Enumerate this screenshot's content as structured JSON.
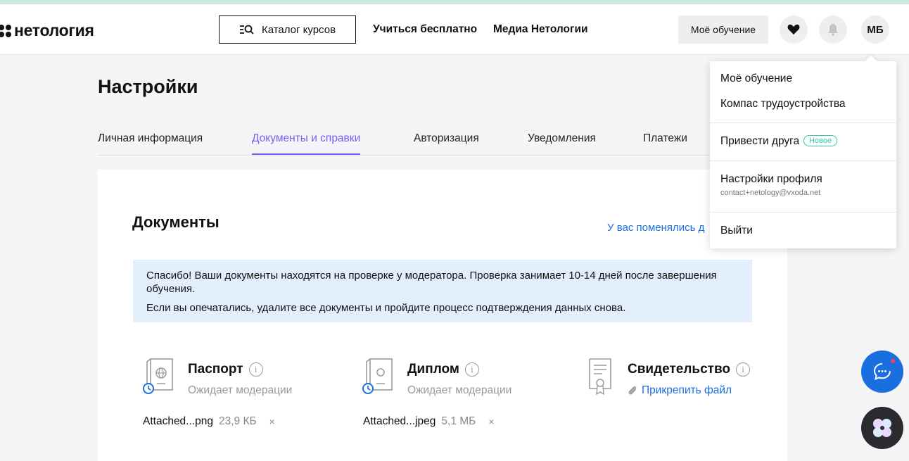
{
  "header": {
    "logo_text": "нетология",
    "catalog_label": "Каталог курсов",
    "nav": [
      "Учиться бесплатно",
      "Медиа Нетологии"
    ],
    "learning_label": "Моё обучение",
    "avatar_initials": "МБ"
  },
  "page": {
    "title": "Настройки",
    "tabs": [
      "Личная информация",
      "Документы и справки",
      "Авторизация",
      "Уведомления",
      "Платежи"
    ],
    "active_tab": "Документы и справки"
  },
  "documents": {
    "title": "Документы",
    "changed_link": "У вас поменялись д",
    "notice_line1": "Спасибо! Ваши документы находятся на проверке у модератора. Проверка занимает 10-14 дней после завершения обучения.",
    "notice_line2": "Если вы опечатались, удалите все документы и пройдите процесс подтверждения данных снова.",
    "items": [
      {
        "name": "Паспорт",
        "status": "Ожидает модерации",
        "file_name": "Attached...png",
        "file_size": "23,9 КБ",
        "remove": "×"
      },
      {
        "name": "Диплом",
        "status": "Ожидает модерации",
        "file_name": "Attached...jpeg",
        "file_size": "5,1 МБ",
        "remove": "×"
      },
      {
        "name": "Свидетельство",
        "attach_label": "Прикрепить файл"
      }
    ]
  },
  "dropdown": {
    "my_learning": "Моё обучение",
    "career_compass": "Компас трудоустройства",
    "invite_friend": "Привести друга",
    "new_badge": "Новое",
    "profile_settings": "Настройки профиля",
    "email": "contact+netology@vxoda.net",
    "logout": "Выйти"
  },
  "colors": {
    "accent_purple": "#7a5cf0",
    "link_blue": "#1a6fe0",
    "notice_bg": "#e2eefc",
    "badge_green": "#36c6a5"
  }
}
